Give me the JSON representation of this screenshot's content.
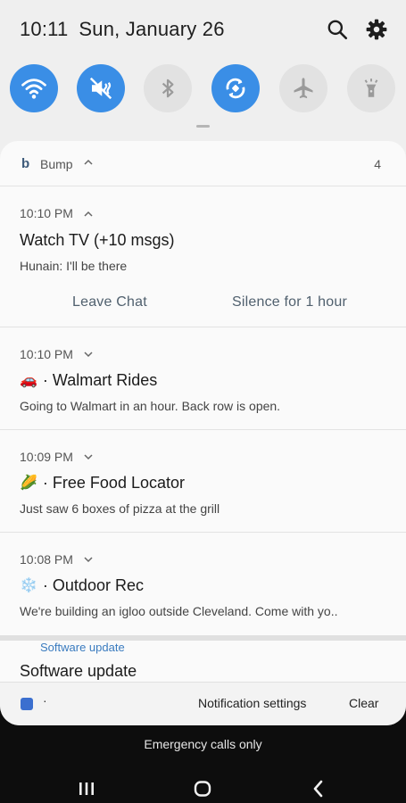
{
  "status_bar": {
    "time": "10:11",
    "date": "Sun, January 26",
    "icons": [
      "search-icon",
      "gear-icon"
    ]
  },
  "quick_toggles": [
    {
      "name": "wifi",
      "state": "on"
    },
    {
      "name": "sound",
      "state": "on"
    },
    {
      "name": "bluetooth",
      "state": "off"
    },
    {
      "name": "auto-rotate",
      "state": "on"
    },
    {
      "name": "airplane",
      "state": "off"
    },
    {
      "name": "flashlight",
      "state": "off"
    }
  ],
  "colors": {
    "toggle_on": "#3a8ee6",
    "toggle_off": "#e2e2e2",
    "link": "#3a7bbf"
  },
  "group": {
    "app_letter": "b",
    "app_name": "Bump",
    "count": "4",
    "notifications": [
      {
        "time": "10:10 PM",
        "title": "Watch TV (+10 msgs)",
        "body": "Hunain: I'll be there",
        "actions": [
          "Leave Chat",
          "Silence for 1 hour"
        ]
      },
      {
        "time": "10:10 PM",
        "emoji": "🚗",
        "title": "· Walmart Rides",
        "body": "Going to Walmart in an hour. Back row is open."
      },
      {
        "time": "10:09 PM",
        "emoji": "🌽",
        "title": "· Free Food Locator",
        "body": "Just saw 6 boxes of pizza at the grill"
      },
      {
        "time": "10:08 PM",
        "emoji": "❄️",
        "title": "· Outdoor Rec",
        "body": "We're building an igloo outside Cleveland. Come with yo.."
      }
    ]
  },
  "software_update": {
    "app_label": "Software update",
    "title": "Software update"
  },
  "footer": {
    "dot": "·",
    "settings_label": "Notification settings",
    "clear_label": "Clear"
  },
  "emergency_text": "Emergency calls only"
}
